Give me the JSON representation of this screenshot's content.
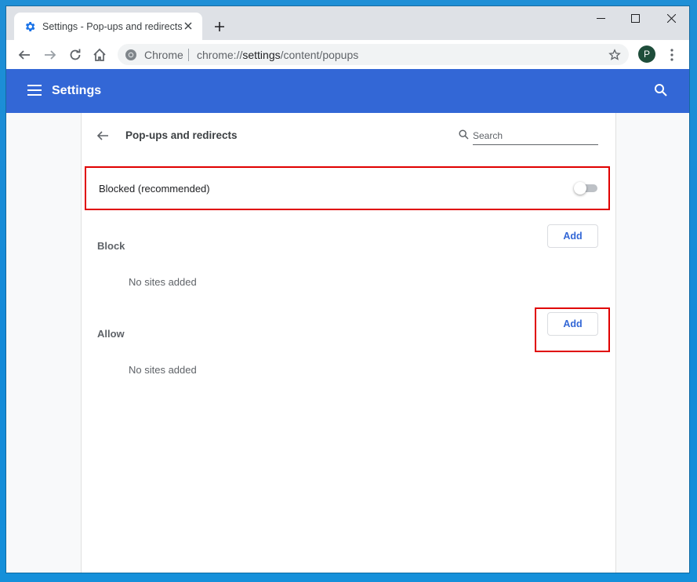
{
  "tab": {
    "title": "Settings - Pop-ups and redirects"
  },
  "omnibox": {
    "site": "Chrome",
    "url_prefix": "chrome://",
    "url_bold": "settings",
    "url_rest": "/content/popups"
  },
  "profile": {
    "initial": "P"
  },
  "header": {
    "title": "Settings"
  },
  "page": {
    "title": "Pop-ups and redirects"
  },
  "search": {
    "placeholder": "Search"
  },
  "blocked": {
    "label": "Blocked (recommended)",
    "enabled": false
  },
  "block_section": {
    "label": "Block",
    "add_label": "Add",
    "empty": "No sites added"
  },
  "allow_section": {
    "label": "Allow",
    "add_label": "Add",
    "empty": "No sites added"
  },
  "colors": {
    "header": "#3367d6",
    "highlight": "#e00000",
    "accent": "#3367d6"
  }
}
